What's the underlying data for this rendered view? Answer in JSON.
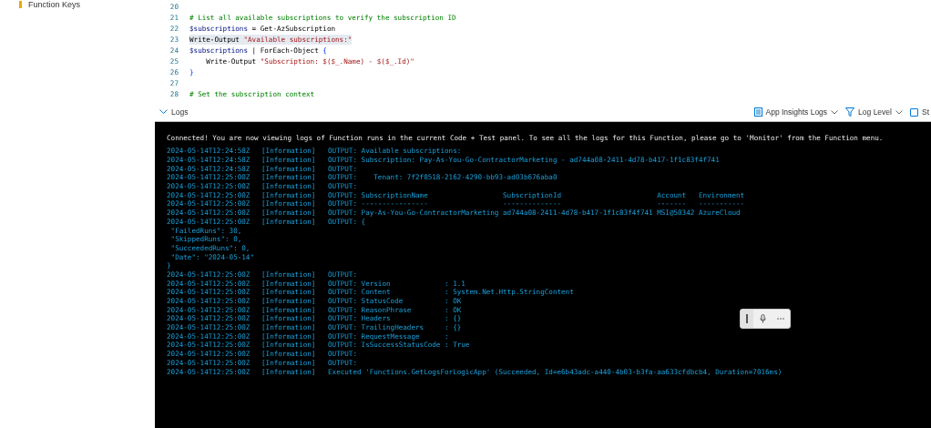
{
  "sidebar": {
    "items": [
      {
        "label": "Function Keys"
      }
    ]
  },
  "editor": {
    "lines": [
      {
        "number": "20"
      },
      {
        "number": "21",
        "highlighted": false,
        "tokens": [
          {
            "kind": "comment",
            "text": "# List all available subscriptions to verify the subscription ID"
          }
        ]
      },
      {
        "number": "22",
        "highlighted": false,
        "tokens": [
          {
            "kind": "variable",
            "text": "$subscriptions"
          },
          {
            "kind": "plain",
            "text": " = Get-AzSubscription"
          }
        ]
      },
      {
        "number": "23",
        "highlighted": true,
        "tokens": [
          {
            "kind": "plain",
            "text": "Write-Output "
          },
          {
            "kind": "string",
            "text": "\"Available subscriptions:\""
          }
        ]
      },
      {
        "number": "24",
        "highlighted": false,
        "tokens": [
          {
            "kind": "variable",
            "text": "$subscriptions"
          },
          {
            "kind": "plain",
            "text": " | ForEach-Object "
          },
          {
            "kind": "brace",
            "text": "{"
          }
        ]
      },
      {
        "number": "25",
        "highlighted": false,
        "tokens": [
          {
            "kind": "plain",
            "text": "    Write-Output "
          },
          {
            "kind": "string",
            "text": "\"Subscription: $($_.Name) - $($_.Id)\""
          }
        ]
      },
      {
        "number": "26",
        "highlighted": false,
        "tokens": [
          {
            "kind": "brace",
            "text": "}"
          }
        ]
      },
      {
        "number": "27"
      },
      {
        "number": "28",
        "highlighted": false,
        "tokens": [
          {
            "kind": "comment",
            "text": "# Set the subscription context"
          }
        ]
      }
    ]
  },
  "logs": {
    "title": "Logs",
    "expanded": true,
    "toolbar": [
      {
        "kind": "dropdown",
        "label": "App Insights Logs"
      },
      {
        "kind": "dropdown",
        "label": "Log Level"
      },
      {
        "kind": "checkbox",
        "label": "St",
        "checked": false
      }
    ],
    "connected_message": "Connected! You are now viewing logs of Function runs in the current Code + Test panel. To see all the logs for this Function, please go to 'Monitor' from the Function menu.",
    "rows": [
      {
        "kind": "entry",
        "timestamp": "2024-05-14T12:24:58Z",
        "level": "[Information]",
        "message": "OUTPUT: Available subscriptions:"
      },
      {
        "kind": "entry",
        "timestamp": "2024-05-14T12:24:58Z",
        "level": "[Information]",
        "message": "OUTPUT: Subscription: Pay-As-You-Go-ContractorMarketing - ad744a08-2411-4d78-b417-1f1c83f4f741"
      },
      {
        "kind": "entry",
        "timestamp": "2024-05-14T12:24:58Z",
        "level": "[Information]",
        "message": "OUTPUT:"
      },
      {
        "kind": "entry",
        "timestamp": "2024-05-14T12:25:00Z",
        "level": "[Information]",
        "message": "OUTPUT:    Tenant: 7f2f0518-2162-4290-bb93-ad03b676aba0"
      },
      {
        "kind": "entry",
        "timestamp": "2024-05-14T12:25:00Z",
        "level": "[Information]",
        "message": "OUTPUT:"
      },
      {
        "kind": "entry",
        "timestamp": "2024-05-14T12:25:00Z",
        "level": "[Information]",
        "message": "OUTPUT: SubscriptionName                  SubscriptionId                       Account   Environment"
      },
      {
        "kind": "entry",
        "timestamp": "2024-05-14T12:25:00Z",
        "level": "[Information]",
        "message": "OUTPUT: ----------------                  --------------                       -------   -----------"
      },
      {
        "kind": "entry",
        "timestamp": "2024-05-14T12:25:00Z",
        "level": "[Information]",
        "message": "OUTPUT: Pay-As-You-Go-ContractorMarketing ad744a08-2411-4d78-b417-1f1c83f4f741 MSI@50342 AzureCloud"
      },
      {
        "kind": "entry",
        "timestamp": "2024-05-14T12:25:00Z",
        "level": "[Information]",
        "message": "OUTPUT: {"
      },
      {
        "kind": "continuation",
        "text": " \"FailedRuns\": 30,"
      },
      {
        "kind": "continuation",
        "text": " \"SkippedRuns\": 0,"
      },
      {
        "kind": "continuation",
        "text": " \"SucceededRuns\": 0,"
      },
      {
        "kind": "continuation",
        "text": " \"Date\": \"2024-05-14\""
      },
      {
        "kind": "continuation",
        "text": "}"
      },
      {
        "kind": "entry",
        "timestamp": "2024-05-14T12:25:00Z",
        "level": "[Information]",
        "message": "OUTPUT:"
      },
      {
        "kind": "entry",
        "timestamp": "2024-05-14T12:25:00Z",
        "level": "[Information]",
        "message": "OUTPUT: Version             : 1.1"
      },
      {
        "kind": "entry",
        "timestamp": "2024-05-14T12:25:00Z",
        "level": "[Information]",
        "message": "OUTPUT: Content             : System.Net.Http.StringContent"
      },
      {
        "kind": "entry",
        "timestamp": "2024-05-14T12:25:00Z",
        "level": "[Information]",
        "message": "OUTPUT: StatusCode          : OK"
      },
      {
        "kind": "entry",
        "timestamp": "2024-05-14T12:25:00Z",
        "level": "[Information]",
        "message": "OUTPUT: ReasonPhrase        : OK"
      },
      {
        "kind": "entry",
        "timestamp": "2024-05-14T12:25:00Z",
        "level": "[Information]",
        "message": "OUTPUT: Headers             : {}"
      },
      {
        "kind": "entry",
        "timestamp": "2024-05-14T12:25:00Z",
        "level": "[Information]",
        "message": "OUTPUT: TrailingHeaders     : {}"
      },
      {
        "kind": "entry",
        "timestamp": "2024-05-14T12:25:00Z",
        "level": "[Information]",
        "message": "OUTPUT: RequestMessage      :"
      },
      {
        "kind": "entry",
        "timestamp": "2024-05-14T12:25:00Z",
        "level": "[Information]",
        "message": "OUTPUT: IsSuccessStatusCode : True"
      },
      {
        "kind": "entry",
        "timestamp": "2024-05-14T12:25:00Z",
        "level": "[Information]",
        "message": "OUTPUT:"
      },
      {
        "kind": "entry",
        "timestamp": "2024-05-14T12:25:00Z",
        "level": "[Information]",
        "message": "OUTPUT:"
      },
      {
        "kind": "entry",
        "timestamp": "2024-05-14T12:25:00Z",
        "level": "[Information]",
        "message": "Executed 'Functions.GetLogsForLogicApp' (Succeeded, Id=e6b43adc-a440-4b03-b3fa-aa633cfdbcb4, Duration=7016ms)"
      }
    ]
  }
}
